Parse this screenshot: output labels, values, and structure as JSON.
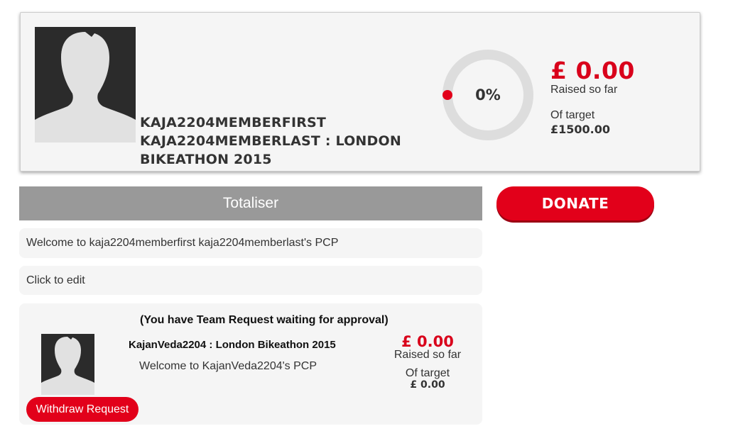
{
  "profile": {
    "avatar_icon": "person-silhouette-icon",
    "title": "KAJA2204MEMBERFIRST KAJA2204MEMBERLAST : LONDON BIKEATHON 2015",
    "progress_percent": 0,
    "progress_label": "0%",
    "raised_amount": "£ 0.00",
    "raised_label": "Raised so far",
    "target_label": "Of target",
    "target_value": "£1500.00"
  },
  "tabs": {
    "totaliser_label": "Totaliser"
  },
  "donate": {
    "label": "DONATE"
  },
  "welcome": {
    "text": "Welcome to kaja2204memberfirst kaja2204memberlast's PCP"
  },
  "edit": {
    "text": "Click to edit"
  },
  "team": {
    "notice": "(You have Team Request waiting for approval)",
    "avatar_icon": "person-silhouette-icon",
    "name": "KajanVeda2204 : London Bikeathon 2015",
    "welcome": "Welcome to KajanVeda2204's PCP",
    "raised_amount": "£ 0.00",
    "raised_label": "Raised so far",
    "target_label": "Of target",
    "target_value": "£ 0.00",
    "withdraw_label": "Withdraw Request"
  },
  "colors": {
    "accent_red": "#e2001a",
    "amount_red": "#d9001b",
    "tab_grey": "#999999",
    "panel_bg": "#f5f5f5",
    "ring_track": "#dddddd"
  }
}
